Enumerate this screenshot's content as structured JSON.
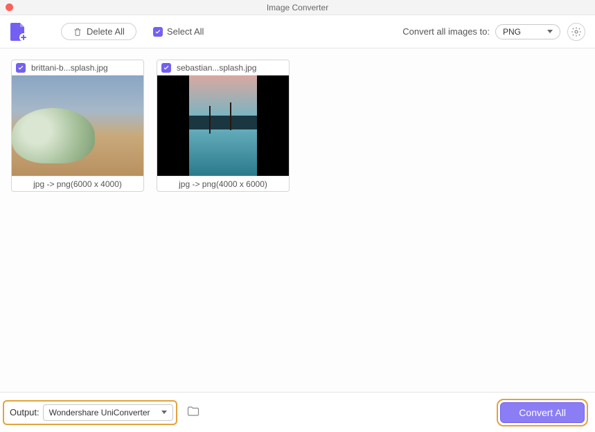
{
  "titlebar": {
    "title": "Image Converter"
  },
  "toolbar": {
    "delete_all": "Delete All",
    "select_all": "Select All",
    "convert_label": "Convert all images to:",
    "format": "PNG"
  },
  "items": [
    {
      "filename": "brittani-b...splash.jpg",
      "conversion": "jpg -> png(6000 x 4000)"
    },
    {
      "filename": "sebastian...splash.jpg",
      "conversion": "jpg -> png(4000 x 6000)"
    }
  ],
  "bottom": {
    "output_label": "Output:",
    "output_value": "Wondershare UniConverter",
    "convert_all": "Convert All"
  }
}
